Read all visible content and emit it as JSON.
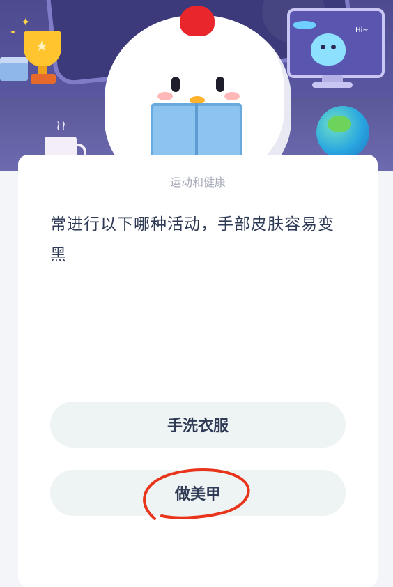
{
  "quiz": {
    "category": "运动和健康",
    "question": "常进行以下哪种活动，手部皮肤容易变黑",
    "options": [
      {
        "label": "手洗衣服"
      },
      {
        "label": "做美甲"
      }
    ]
  },
  "illustration": {
    "monitor_text": "Hi~"
  },
  "annotation": {
    "circled_option": "做美甲",
    "color": "#e8341a"
  },
  "colors": {
    "card_bg": "#ffffff",
    "option_bg": "#eef3f4",
    "text_primary": "#2f3a55",
    "text_muted": "#a7abb8"
  }
}
